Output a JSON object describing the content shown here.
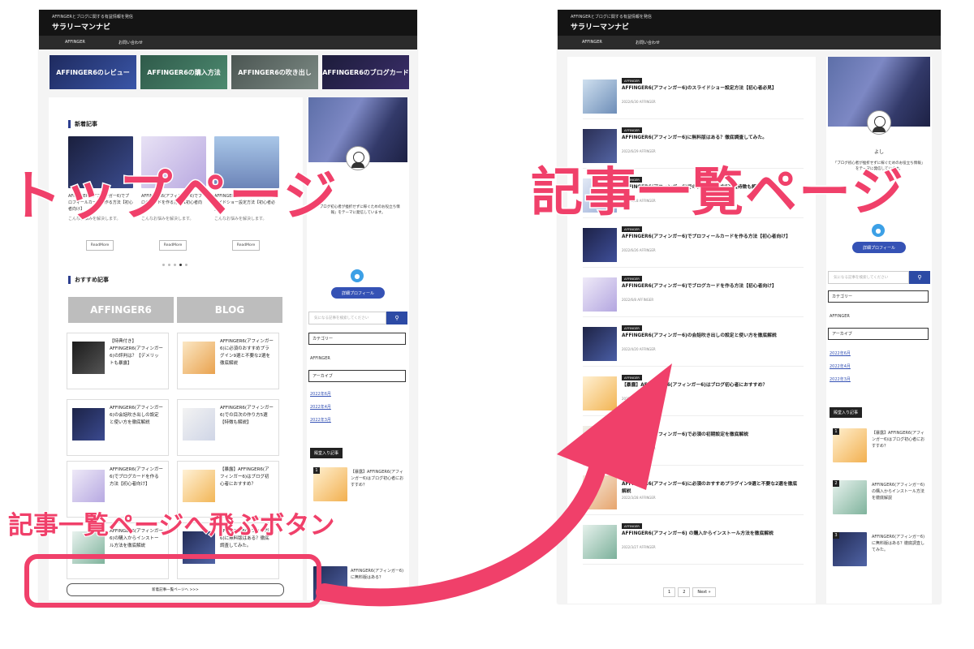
{
  "left": {
    "header": {
      "tagline": "AFFINGERとブログに関する有益情報を発信",
      "site": "サラリーマンナビ"
    },
    "nav": [
      "AFFINGER",
      "お問い合わせ"
    ],
    "banners": [
      {
        "label": "AFFINGER6のレビュー",
        "color": "#1e2a5e"
      },
      {
        "label": "AFFINGER6の購入方法",
        "color": "#2f5a4a"
      },
      {
        "label": "AFFINGER6の吹き出し",
        "color": "#4b5552"
      },
      {
        "label": "AFFINGER6のブログカード",
        "color": "#1c1c3a"
      }
    ],
    "new_section": "新着記事",
    "slides": [
      {
        "text": "AFFINGER6(アフィンガー6)でプロフィールカードを作る方法【初心者向け】",
        "excerpt": "こんなお悩みを解決します。",
        "read_more": "ReadMore"
      },
      {
        "text": "AFFINGER6(アフィンガー6)でブログカードを作る方法【初心者向け】",
        "excerpt": "こんなお悩みを解決します。",
        "read_more": "ReadMore"
      },
      {
        "text": "AFFINGER6(アフィンガー6)のスライドショー設定方法【初心者必見】",
        "excerpt": "こんなお悩みを解決します。",
        "read_more": "ReadMore"
      }
    ],
    "recommend_section": "おすすめ記事",
    "rec_buttons": [
      "AFFINGER6",
      "BLOG"
    ],
    "cards": [
      "【特典付き】AFFINGER6(アフィンガー6)の評判は？【デメリットも暴露】",
      "AFFINGER6(アフィンガー6)に必須のおすすめプラグイン9選と不要な2選を徹底解説",
      "AFFINGER6(アフィンガー6)の会話吹き出しの設定と使い方を徹底解説",
      "AFFINGER6(アフィンガー6)での目次の作り方5選【特徴も解説】",
      "AFFINGER6(アフィンガー6)でブログカードを作る方法【初心者向け】",
      "【暴露】AFFINGER6(アフィンガー6)はブログ初心者におすすめ？",
      "AFFINGER6(アフィンガー6)の購入からインストール方法を徹底解説",
      "AFFINGER6(アフィンガー6)に無料版はある？徹底調査してみた。"
    ],
    "list_button": "新着記事一覧ページへ >>>",
    "sidebar": {
      "profile_text": "「ブログ初心者が挫折せずに稼ぐためのお役立ち情報」をテーマに発信しています。",
      "profile_btn": "詳細プロフィール",
      "search_placeholder": "気になる記事を検索してください",
      "category_title": "カテゴリー",
      "category_item": "AFFINGER",
      "archive_title": "アーカイブ",
      "archives": [
        "2022年6月",
        "2022年4月",
        "2022年3月"
      ],
      "popular_title": "殿堂入り記事",
      "popular": [
        "【暴露】AFFINGER6(アフィンガー6)はブログ初心者におすすめ？",
        "AFFINGER6(アフィンガー6)に無料版はある？"
      ]
    }
  },
  "right": {
    "header": {
      "tagline": "AFFINGERとブログに関する有益情報を発信",
      "site": "サラリーマンナビ"
    },
    "nav": [
      "AFFINGER",
      "お問い合わせ"
    ],
    "posts": [
      {
        "cat": "AFFINGER",
        "title": "AFFINGER6(アフィンガー6)のスライドショー設定方法【初心者必見】",
        "date": "2022/6/30",
        "tag": "AFFINGER"
      },
      {
        "cat": "AFFINGER",
        "title": "AFFINGER6(アフィンガー6)に無料版はある？徹底調査してみた。",
        "date": "2022/6/29",
        "tag": "AFFINGER"
      },
      {
        "cat": "AFFINGER",
        "title": "AFFINGER6(アフィンガー6)での目次の作り方5選【特徴も解説】",
        "date": "2022/6/28",
        "tag": "AFFINGER"
      },
      {
        "cat": "AFFINGER",
        "title": "AFFINGER6(アフィンガー6)でプロフィールカードを作る方法【初心者向け】",
        "date": "2022/6/26",
        "tag": "AFFINGER"
      },
      {
        "cat": "AFFINGER",
        "title": "AFFINGER6(アフィンガー6)でブログカードを作る方法【初心者向け】",
        "date": "2022/6/8",
        "tag": "AFFINGER"
      },
      {
        "cat": "AFFINGER",
        "title": "AFFINGER6(アフィンガー6)の会話吹き出しの設定と使い方を徹底解説",
        "date": "2022/4/20",
        "tag": "AFFINGER"
      },
      {
        "cat": "AFFINGER",
        "title": "【暴露】AFFINGER6(アフィンガー6)はブログ初心者におすすめ？",
        "date": "2022/4/15",
        "tag": "AFFINGER"
      },
      {
        "cat": "AFFINGER",
        "title": "AFFINGER6(アフィンガー6)で必須の初期設定を徹底解説",
        "date": "2022/4/10",
        "tag": "AFFINGER"
      },
      {
        "cat": "AFFINGER",
        "title": "AFFINGER6(アフィンガー6)に必須のおすすめプラグイン9選と不要な2選を徹底解説",
        "date": "2022/3/28",
        "tag": "AFFINGER"
      },
      {
        "cat": "AFFINGER",
        "title": "AFFINGER6(アフィンガー6) の購入からインストール方法を徹底解説",
        "date": "2022/3/27",
        "tag": "AFFINGER"
      }
    ],
    "pager": [
      "1",
      "2",
      "Next »"
    ],
    "sidebar": {
      "name": "よし",
      "profile_text": "「ブログ初心者が挫折せずに稼ぐためのお役立ち情報」をテーマに発信しています。",
      "profile_btn": "詳細プロフィール",
      "search_placeholder": "気になる記事を検索してください",
      "category_title": "カテゴリー",
      "category_item": "AFFINGER",
      "archive_title": "アーカイブ",
      "archives": [
        "2022年6月",
        "2022年4月",
        "2022年3月"
      ],
      "popular_title": "殿堂入り記事",
      "popular": [
        "【暴露】AFFINGER6(アフィンガー6)はブログ初心者におすすめ？",
        "AFFINGER6(アフィンガー6) の購入からインストール方法を徹底解説",
        "AFFINGER6(アフィンガー6)に無料版はある？徹底調査してみた。"
      ]
    }
  },
  "annotations": {
    "top_label": "トップページ",
    "list_label": "記事一覧ページ",
    "button_label": "記事一覧ページへ飛ぶボタン",
    "accent": "#f0406a"
  }
}
